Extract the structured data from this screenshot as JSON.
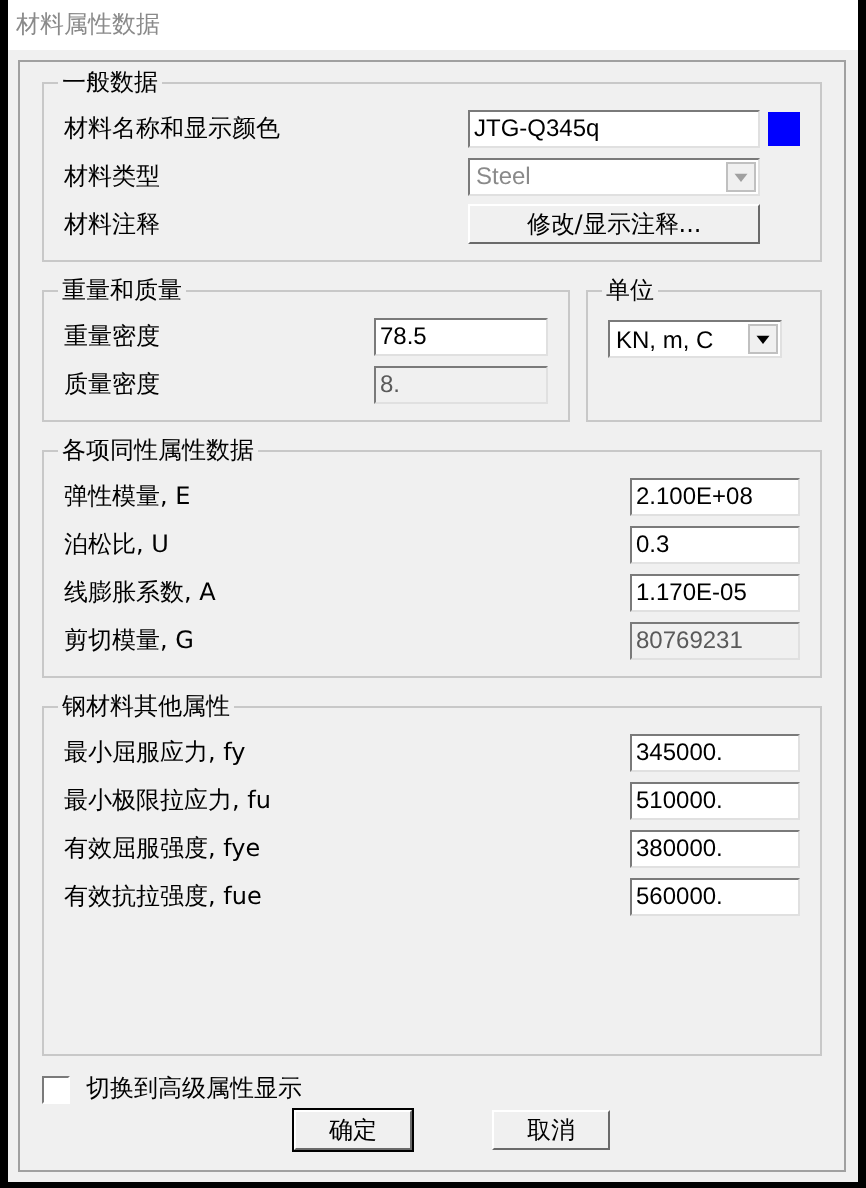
{
  "window": {
    "title": "材料属性数据"
  },
  "general": {
    "title": "一般数据",
    "name_row": {
      "label": "材料名称和显示颜色",
      "value": "JTG-Q345q",
      "color": "#0000ff"
    },
    "type_row": {
      "label": "材料类型",
      "value": "Steel",
      "disabled": true
    },
    "note_row": {
      "label": "材料注释",
      "button": "修改/显示注释..."
    }
  },
  "weight": {
    "title": "重量和质量",
    "rows": [
      {
        "label": "重量密度",
        "value": "78.5",
        "disabled": false
      },
      {
        "label": "质量密度",
        "value": "8.",
        "disabled": true
      }
    ]
  },
  "units": {
    "title": "单位",
    "value": "KN, m, C",
    "disabled": false
  },
  "isotropic": {
    "title": "各项同性属性数据",
    "rows": [
      {
        "label": "弹性模量, E",
        "value": "2.100E+08",
        "disabled": false
      },
      {
        "label": "泊松比, U",
        "value": "0.3",
        "disabled": false
      },
      {
        "label": "线膨胀系数, A",
        "value": "1.170E-05",
        "disabled": false
      },
      {
        "label": "剪切模量, G",
        "value": "80769231",
        "disabled": true
      }
    ]
  },
  "steel": {
    "title": "钢材料其他属性",
    "rows": [
      {
        "label": "最小屈服应力, fy",
        "value": "345000.",
        "disabled": false
      },
      {
        "label": "最小极限拉应力, fu",
        "value": "510000.",
        "disabled": false
      },
      {
        "label": "有效屈服强度, fye",
        "value": "380000.",
        "disabled": false
      },
      {
        "label": "有效抗拉强度, fue",
        "value": "560000.",
        "disabled": false
      }
    ]
  },
  "advanced": {
    "label": "切换到高级属性显示",
    "checked": false
  },
  "buttons": [
    {
      "label": "确定",
      "default": true
    },
    {
      "label": "取消",
      "default": false
    }
  ]
}
